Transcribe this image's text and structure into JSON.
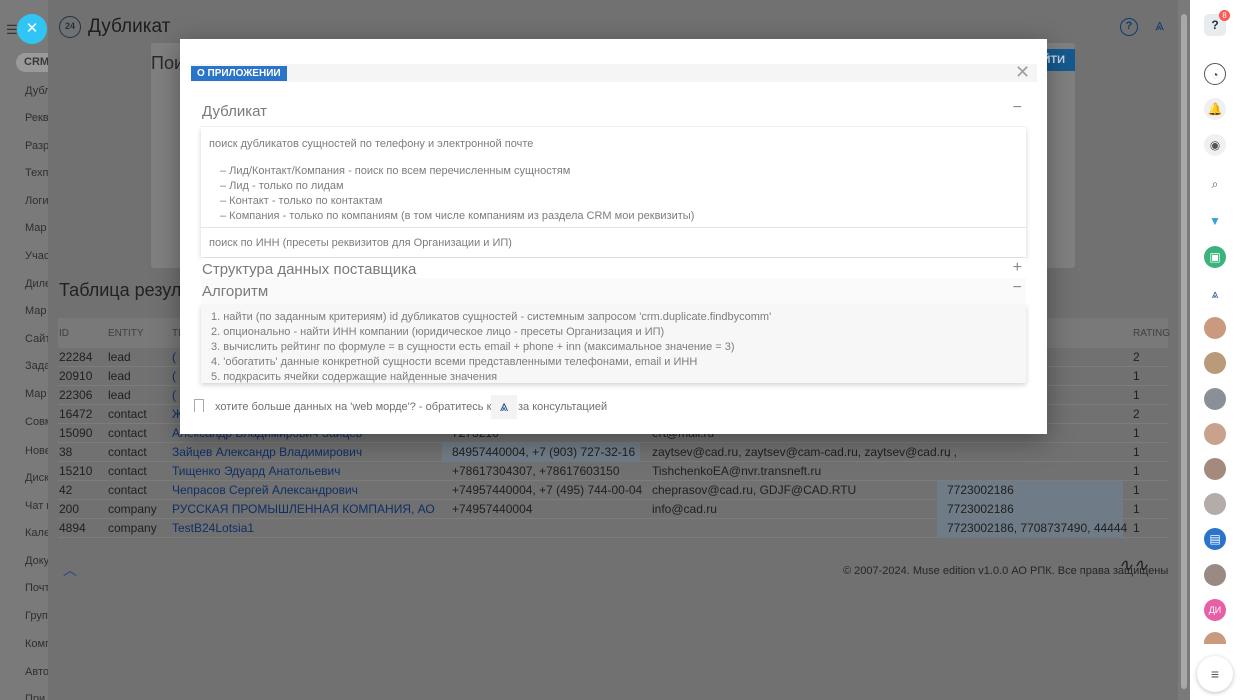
{
  "left_nav": {
    "crm_label": "CRM",
    "items": [
      "Дубл",
      "Рекв",
      "Разр",
      "Техп",
      "Логи",
      "Мар",
      "Учас",
      "Диле",
      "Мар",
      "Сайт",
      "Зада",
      "Мар",
      "Совм",
      "Нове",
      "Диск",
      "Чат и",
      "Кале",
      "Доку",
      "Почт",
      "Груп",
      "Комп",
      "Авто",
      "При"
    ]
  },
  "main": {
    "title": "Дубликат",
    "logo_text": "24",
    "search_title": "Пои",
    "search_button": "ЙТИ",
    "results_title": "Таблица резуль",
    "columns": {
      "id": "ID",
      "entity": "ENTITY",
      "title": "TI",
      "rating": "RATING"
    },
    "rows": [
      {
        "id": "22284",
        "entity": "lead",
        "title": "(",
        "phone": "",
        "email": "",
        "inn": "",
        "rating": "2"
      },
      {
        "id": "20910",
        "entity": "lead",
        "title": "(",
        "phone": "",
        "email": "",
        "inn": "",
        "rating": "1"
      },
      {
        "id": "22306",
        "entity": "lead",
        "title": "(",
        "phone": "",
        "email": "",
        "inn": "",
        "rating": "1"
      },
      {
        "id": "16472",
        "entity": "contact",
        "title": "Ж",
        "phone": "",
        "email": "",
        "inn": "",
        "rating": "2"
      },
      {
        "id": "15090",
        "entity": "contact",
        "title": "Александр Владимирович Зайцев",
        "phone": "7273216",
        "email": "ert@mail.ru",
        "inn": "",
        "rating": "1"
      },
      {
        "id": "38",
        "entity": "contact",
        "title": "Зайцев Александр Владимирович",
        "phone": "84957440004, +7 (903) 727-32-16",
        "email": "zaytsev@cad.ru, zaytsev@cam-cad.ru, zaytsev@cad.ru",
        "inn": ", ,",
        "rating": "1"
      },
      {
        "id": "15210",
        "entity": "contact",
        "title": "Тищенко Эдуард Анатольевич",
        "phone": "+78617304307, +78617603150",
        "email": "TishchenkoEA@nvr.transneft.ru",
        "inn": "",
        "rating": "1"
      },
      {
        "id": "42",
        "entity": "contact",
        "title": "Чепрасов Сергей Александрович",
        "phone": "+74957440004, +7 (495) 744-00-04",
        "email": "cheprasov@cad.ru, GDJF@CAD.RTU",
        "inn": "7723002186",
        "rating": "1"
      },
      {
        "id": "200",
        "entity": "company",
        "title": "РУССКАЯ ПРОМЫШЛЕННАЯ КОМПАНИЯ, АО",
        "phone": "+74957440004",
        "email": "info@cad.ru",
        "inn": "7723002186",
        "rating": "1"
      },
      {
        "id": "4894",
        "entity": "company",
        "title": "TestB24Lotsia1",
        "phone": "",
        "email": "",
        "inn": "7723002186, 7708737490, 44444",
        "rating": "1"
      }
    ],
    "copyright": "© 2007-2024. Muse edition v1.0.0 АО РПК. Все права защищены"
  },
  "right_bar": {
    "help_badge": "8",
    "initials": "ДИ"
  },
  "dialog": {
    "tab_label": "О ПРИЛОЖЕНИИ",
    "section1": {
      "title": "Дубликат",
      "toggle": "−",
      "intro": "поиск дубликатов сущностей по телефону и электронной почте",
      "items": [
        "–  Лид/Контакт/Компания - поиск по всем перечисленным сущностям",
        "–  Лид - только по лидам",
        "–  Контакт - только по контактам",
        "–  Компания - только по компаниям (в том числе компаниям из раздела CRM мои реквизиты)"
      ],
      "inn_text": "поиск по ИНН (пресеты реквизитов для Организации и ИП)"
    },
    "section2": {
      "title": "Структура данных поставщика",
      "toggle": "+"
    },
    "section3": {
      "title": "Алгоритм",
      "toggle": "−",
      "steps": [
        "1. найти (по заданным критериям) id дубликатов сущностей - системным запросом 'crm.duplicate.findbycomm'",
        "2. опционально - найти ИНН компании (юридическое лицо - пресеты Организация и ИП)",
        "3. вычислить рейтинг по формуле = в сущности есть email + phone + inn (максимальное значение = 3)",
        "4. 'обогатить' данные конкретной сущности всеми представленными телефонами, email и ИНН",
        "5. подкрасить ячейки содержащие найденные значения"
      ]
    },
    "footer": {
      "text_before": "хотите больше данных на 'web морде'? - обратитесь к нам",
      "text_after": "за консультацией"
    }
  }
}
